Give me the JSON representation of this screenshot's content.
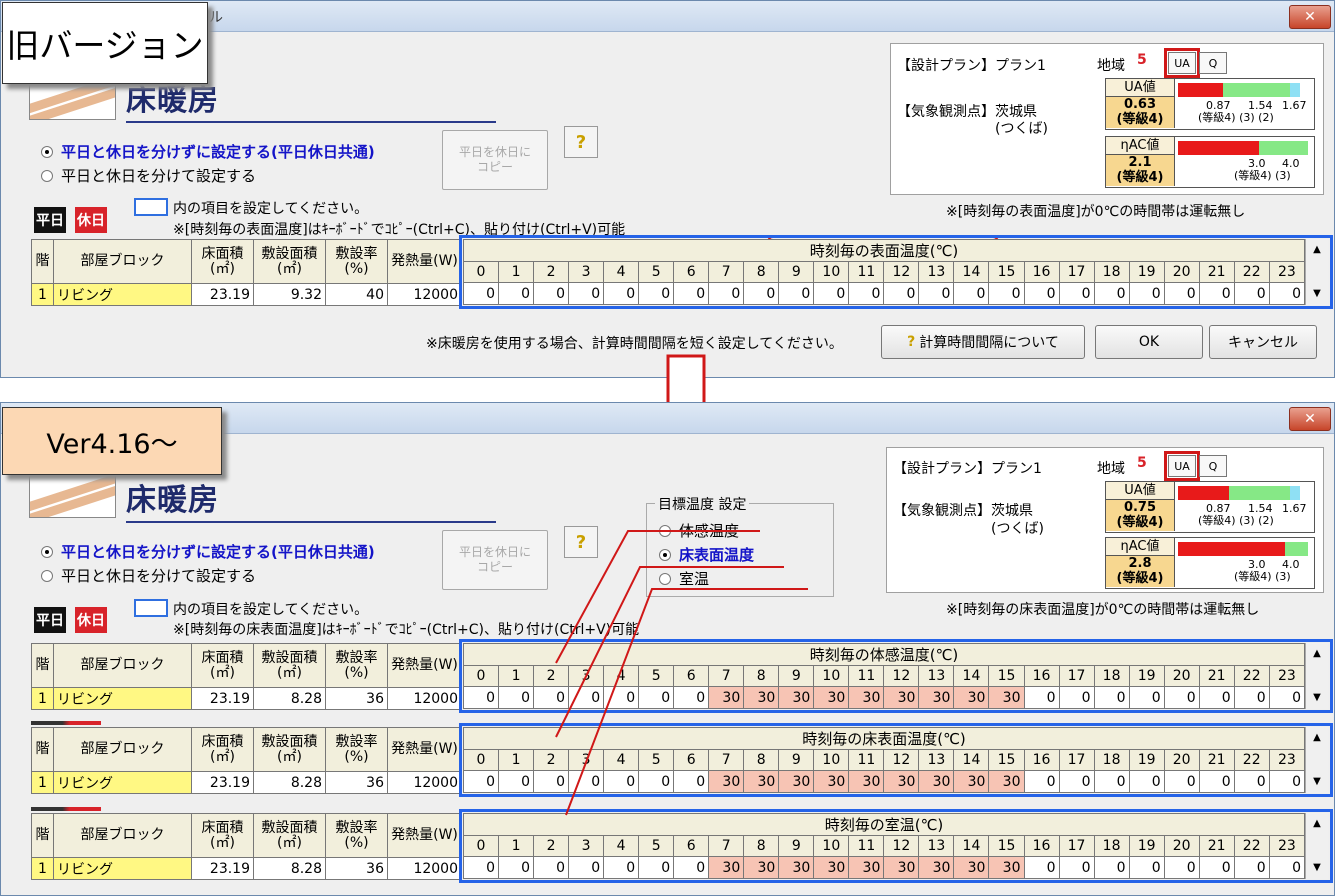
{
  "labels": {
    "old_version": "旧バージョン",
    "new_version": "Ver4.16～"
  },
  "old_window": {
    "title": "ル",
    "heading": "床暖房",
    "radio_common": "平日と休日を分けずに設定する(平日休日共通)",
    "radio_separate": "平日と休日を分けて設定する",
    "copy_button": [
      "平日を休日に",
      "コピー"
    ],
    "help_icon": "?",
    "tag_weekday": "平日",
    "tag_holiday": "休日",
    "note_blue": "内の項目を設定してください。",
    "note_copy": "※[時刻毎の表面温度]はｷｰﾎﾞｰﾄﾞでｺﾋﾟｰ(Ctrl+C)、貼り付け(Ctrl+V)可能",
    "note_zero": "※[時刻毎の表面温度]が0℃の時間帯は運転無し",
    "plan_label": "【設計プラン】プラン1",
    "region_label": "地域",
    "region_value": "5",
    "station_label": "【気象観測点】茨城県",
    "station_sub": "(つくば)",
    "ua_btn": "UA",
    "q_btn": "Q",
    "ua_label": "UA値",
    "ua_value": "0.63",
    "ua_grade": "(等級4)",
    "ua_scale": [
      "0.87",
      "1.54",
      "1.67"
    ],
    "ua_scale_sub": "(等級4) (3)   (2)",
    "ac_label": "ηAC値",
    "ac_value": "2.1",
    "ac_grade": "(等級4)",
    "ac_scale": [
      "3.0",
      "4.0"
    ],
    "ac_scale_sub": "(等級4) (3)",
    "ua_fill": 0.37,
    "ac_fill": 0.62,
    "table": {
      "headers": [
        "階",
        "部屋ブロック",
        "床面積(㎡)",
        "敷設面積(㎡)",
        "敷設率(%)",
        "発熱量(W)"
      ],
      "row": [
        "1",
        "リビング",
        "23.19",
        "9.32",
        "40",
        "12000"
      ],
      "hour_title": "時刻毎の表面温度(℃)",
      "values": [
        0,
        0,
        0,
        0,
        0,
        0,
        0,
        0,
        0,
        0,
        0,
        0,
        0,
        0,
        0,
        0,
        0,
        0,
        0,
        0,
        0,
        0,
        0,
        0
      ]
    },
    "footer_note": "※床暖房を使用する場合、計算時間間隔を短く設定してください。",
    "calc_button": "計算時間間隔について",
    "ok_button": "OK",
    "cancel_button": "キャンセル"
  },
  "new_window": {
    "heading": "床暖房",
    "radio_common": "平日と休日を分けずに設定する(平日休日共通)",
    "radio_separate": "平日と休日を分けて設定する",
    "copy_button": [
      "平日を休日に",
      "コピー"
    ],
    "help_icon": "?",
    "tag_weekday": "平日",
    "tag_holiday": "休日",
    "target_group": "目標温度 設定",
    "target_options": [
      "体感温度",
      "床表面温度",
      "室温"
    ],
    "note_blue": "内の項目を設定してください。",
    "note_copy": "※[時刻毎の床表面温度]はｷｰﾎﾞｰﾄﾞでｺﾋﾟｰ(Ctrl+C)、貼り付け(Ctrl+V)可能",
    "note_zero": "※[時刻毎の床表面温度]が0℃の時間帯は運転無し",
    "plan_label": "【設計プラン】プラン1",
    "region_label": "地域",
    "region_value": "5",
    "station_label": "【気象観測点】茨城県",
    "station_sub": "(つくば)",
    "ua_btn": "UA",
    "q_btn": "Q",
    "ua_label": "UA値",
    "ua_value": "0.75",
    "ua_grade": "(等級4)",
    "ua_scale": [
      "0.87",
      "1.54",
      "1.67"
    ],
    "ua_scale_sub": "(等級4) (3)   (2)",
    "ac_label": "ηAC値",
    "ac_value": "2.8",
    "ac_grade": "(等級4)",
    "ac_scale": [
      "3.0",
      "4.0"
    ],
    "ac_scale_sub": "(等級4) (3)",
    "ua_fill": 0.42,
    "ac_fill": 0.82,
    "headers": [
      "階",
      "部屋ブロック",
      "床面積(㎡)",
      "敷設面積(㎡)",
      "敷設率(%)",
      "発熱量(W)"
    ],
    "row": [
      "1",
      "リビング",
      "23.19",
      "8.28",
      "36",
      "12000"
    ],
    "tables": [
      {
        "hour_title": "時刻毎の体感温度(℃)",
        "values": [
          0,
          0,
          0,
          0,
          0,
          0,
          0,
          30,
          30,
          30,
          30,
          30,
          30,
          30,
          30,
          30,
          0,
          0,
          0,
          0,
          0,
          0,
          0,
          0
        ]
      },
      {
        "hour_title": "時刻毎の床表面温度(℃)",
        "values": [
          0,
          0,
          0,
          0,
          0,
          0,
          0,
          30,
          30,
          30,
          30,
          30,
          30,
          30,
          30,
          30,
          0,
          0,
          0,
          0,
          0,
          0,
          0,
          0
        ]
      },
      {
        "hour_title": "時刻毎の室温(℃)",
        "values": [
          0,
          0,
          0,
          0,
          0,
          0,
          0,
          30,
          30,
          30,
          30,
          30,
          30,
          30,
          30,
          30,
          0,
          0,
          0,
          0,
          0,
          0,
          0,
          0
        ]
      }
    ]
  },
  "hours": [
    "0",
    "1",
    "2",
    "3",
    "4",
    "5",
    "6",
    "7",
    "8",
    "9",
    "10",
    "11",
    "12",
    "13",
    "14",
    "15",
    "16",
    "17",
    "18",
    "19",
    "20",
    "21",
    "22",
    "23"
  ],
  "colors": {
    "accent_blue": "#2563e8",
    "highlight_red": "#d01818",
    "pink_cell": "#f7c4b4",
    "bar_red": "#e81a1a",
    "bar_green": "#86e886"
  }
}
